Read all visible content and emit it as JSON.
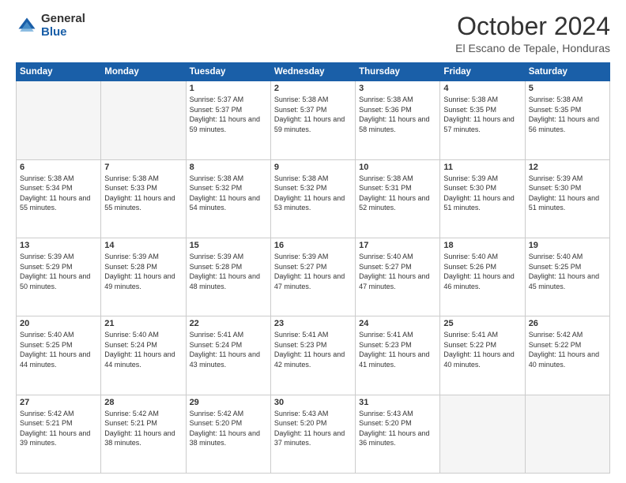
{
  "header": {
    "logo_general": "General",
    "logo_blue": "Blue",
    "month": "October 2024",
    "location": "El Escano de Tepale, Honduras"
  },
  "days_of_week": [
    "Sunday",
    "Monday",
    "Tuesday",
    "Wednesday",
    "Thursday",
    "Friday",
    "Saturday"
  ],
  "weeks": [
    [
      {
        "day": "",
        "info": ""
      },
      {
        "day": "",
        "info": ""
      },
      {
        "day": "1",
        "info": "Sunrise: 5:37 AM\nSunset: 5:37 PM\nDaylight: 11 hours and 59 minutes."
      },
      {
        "day": "2",
        "info": "Sunrise: 5:38 AM\nSunset: 5:37 PM\nDaylight: 11 hours and 59 minutes."
      },
      {
        "day": "3",
        "info": "Sunrise: 5:38 AM\nSunset: 5:36 PM\nDaylight: 11 hours and 58 minutes."
      },
      {
        "day": "4",
        "info": "Sunrise: 5:38 AM\nSunset: 5:35 PM\nDaylight: 11 hours and 57 minutes."
      },
      {
        "day": "5",
        "info": "Sunrise: 5:38 AM\nSunset: 5:35 PM\nDaylight: 11 hours and 56 minutes."
      }
    ],
    [
      {
        "day": "6",
        "info": "Sunrise: 5:38 AM\nSunset: 5:34 PM\nDaylight: 11 hours and 55 minutes."
      },
      {
        "day": "7",
        "info": "Sunrise: 5:38 AM\nSunset: 5:33 PM\nDaylight: 11 hours and 55 minutes."
      },
      {
        "day": "8",
        "info": "Sunrise: 5:38 AM\nSunset: 5:32 PM\nDaylight: 11 hours and 54 minutes."
      },
      {
        "day": "9",
        "info": "Sunrise: 5:38 AM\nSunset: 5:32 PM\nDaylight: 11 hours and 53 minutes."
      },
      {
        "day": "10",
        "info": "Sunrise: 5:38 AM\nSunset: 5:31 PM\nDaylight: 11 hours and 52 minutes."
      },
      {
        "day": "11",
        "info": "Sunrise: 5:39 AM\nSunset: 5:30 PM\nDaylight: 11 hours and 51 minutes."
      },
      {
        "day": "12",
        "info": "Sunrise: 5:39 AM\nSunset: 5:30 PM\nDaylight: 11 hours and 51 minutes."
      }
    ],
    [
      {
        "day": "13",
        "info": "Sunrise: 5:39 AM\nSunset: 5:29 PM\nDaylight: 11 hours and 50 minutes."
      },
      {
        "day": "14",
        "info": "Sunrise: 5:39 AM\nSunset: 5:28 PM\nDaylight: 11 hours and 49 minutes."
      },
      {
        "day": "15",
        "info": "Sunrise: 5:39 AM\nSunset: 5:28 PM\nDaylight: 11 hours and 48 minutes."
      },
      {
        "day": "16",
        "info": "Sunrise: 5:39 AM\nSunset: 5:27 PM\nDaylight: 11 hours and 47 minutes."
      },
      {
        "day": "17",
        "info": "Sunrise: 5:40 AM\nSunset: 5:27 PM\nDaylight: 11 hours and 47 minutes."
      },
      {
        "day": "18",
        "info": "Sunrise: 5:40 AM\nSunset: 5:26 PM\nDaylight: 11 hours and 46 minutes."
      },
      {
        "day": "19",
        "info": "Sunrise: 5:40 AM\nSunset: 5:25 PM\nDaylight: 11 hours and 45 minutes."
      }
    ],
    [
      {
        "day": "20",
        "info": "Sunrise: 5:40 AM\nSunset: 5:25 PM\nDaylight: 11 hours and 44 minutes."
      },
      {
        "day": "21",
        "info": "Sunrise: 5:40 AM\nSunset: 5:24 PM\nDaylight: 11 hours and 44 minutes."
      },
      {
        "day": "22",
        "info": "Sunrise: 5:41 AM\nSunset: 5:24 PM\nDaylight: 11 hours and 43 minutes."
      },
      {
        "day": "23",
        "info": "Sunrise: 5:41 AM\nSunset: 5:23 PM\nDaylight: 11 hours and 42 minutes."
      },
      {
        "day": "24",
        "info": "Sunrise: 5:41 AM\nSunset: 5:23 PM\nDaylight: 11 hours and 41 minutes."
      },
      {
        "day": "25",
        "info": "Sunrise: 5:41 AM\nSunset: 5:22 PM\nDaylight: 11 hours and 40 minutes."
      },
      {
        "day": "26",
        "info": "Sunrise: 5:42 AM\nSunset: 5:22 PM\nDaylight: 11 hours and 40 minutes."
      }
    ],
    [
      {
        "day": "27",
        "info": "Sunrise: 5:42 AM\nSunset: 5:21 PM\nDaylight: 11 hours and 39 minutes."
      },
      {
        "day": "28",
        "info": "Sunrise: 5:42 AM\nSunset: 5:21 PM\nDaylight: 11 hours and 38 minutes."
      },
      {
        "day": "29",
        "info": "Sunrise: 5:42 AM\nSunset: 5:20 PM\nDaylight: 11 hours and 38 minutes."
      },
      {
        "day": "30",
        "info": "Sunrise: 5:43 AM\nSunset: 5:20 PM\nDaylight: 11 hours and 37 minutes."
      },
      {
        "day": "31",
        "info": "Sunrise: 5:43 AM\nSunset: 5:20 PM\nDaylight: 11 hours and 36 minutes."
      },
      {
        "day": "",
        "info": ""
      },
      {
        "day": "",
        "info": ""
      }
    ]
  ]
}
